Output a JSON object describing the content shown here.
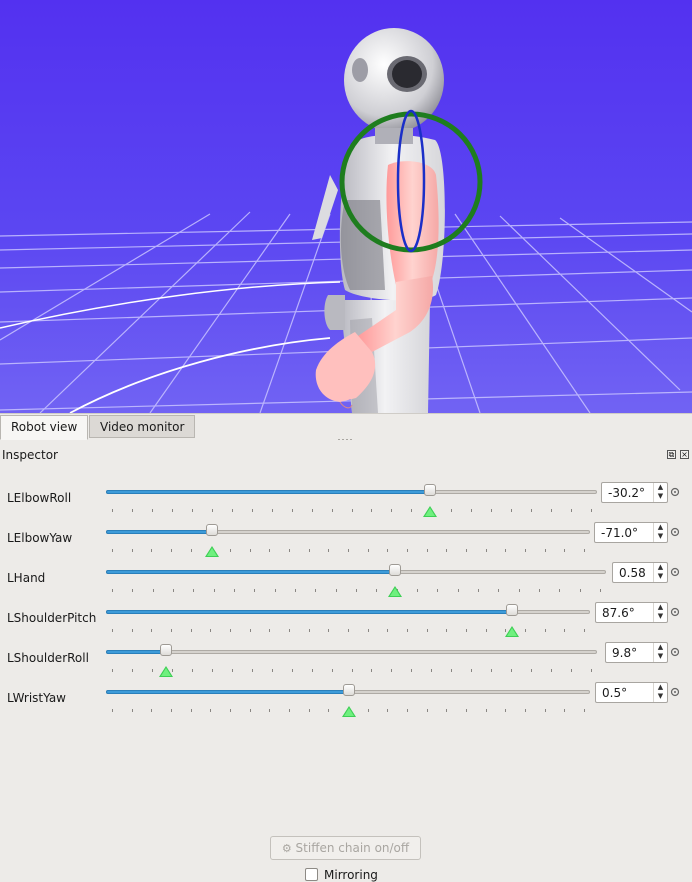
{
  "tabs": [
    {
      "label": "Robot view",
      "active": true
    },
    {
      "label": "Video monitor",
      "active": false
    }
  ],
  "inspector": {
    "title": "Inspector",
    "joints": [
      {
        "name": "LElbowRoll",
        "value": "-30.2°",
        "slider_fraction": 0.663,
        "target_fraction": 0.663
      },
      {
        "name": "LElbowYaw",
        "value": "-71.0°",
        "slider_fraction": 0.212,
        "target_fraction": 0.212
      },
      {
        "name": "LHand",
        "value": "0.58",
        "slider_fraction": 0.58,
        "target_fraction": 0.58
      },
      {
        "name": "LShoulderPitch",
        "value": "87.6°",
        "slider_fraction": 0.848,
        "target_fraction": 0.848
      },
      {
        "name": "LShoulderRoll",
        "value": "9.8°",
        "slider_fraction": 0.113,
        "target_fraction": 0.113
      },
      {
        "name": "LWristYaw",
        "value": "0.5°",
        "slider_fraction": 0.503,
        "target_fraction": 0.503
      }
    ]
  },
  "stiffen_label": "Stiffen chain on/off",
  "mirroring_label": "Mirroring",
  "colors": {
    "viewport_background": "#5a40f2",
    "slider_fill": "#3d9bd9",
    "target_marker": "#3ecf55"
  }
}
